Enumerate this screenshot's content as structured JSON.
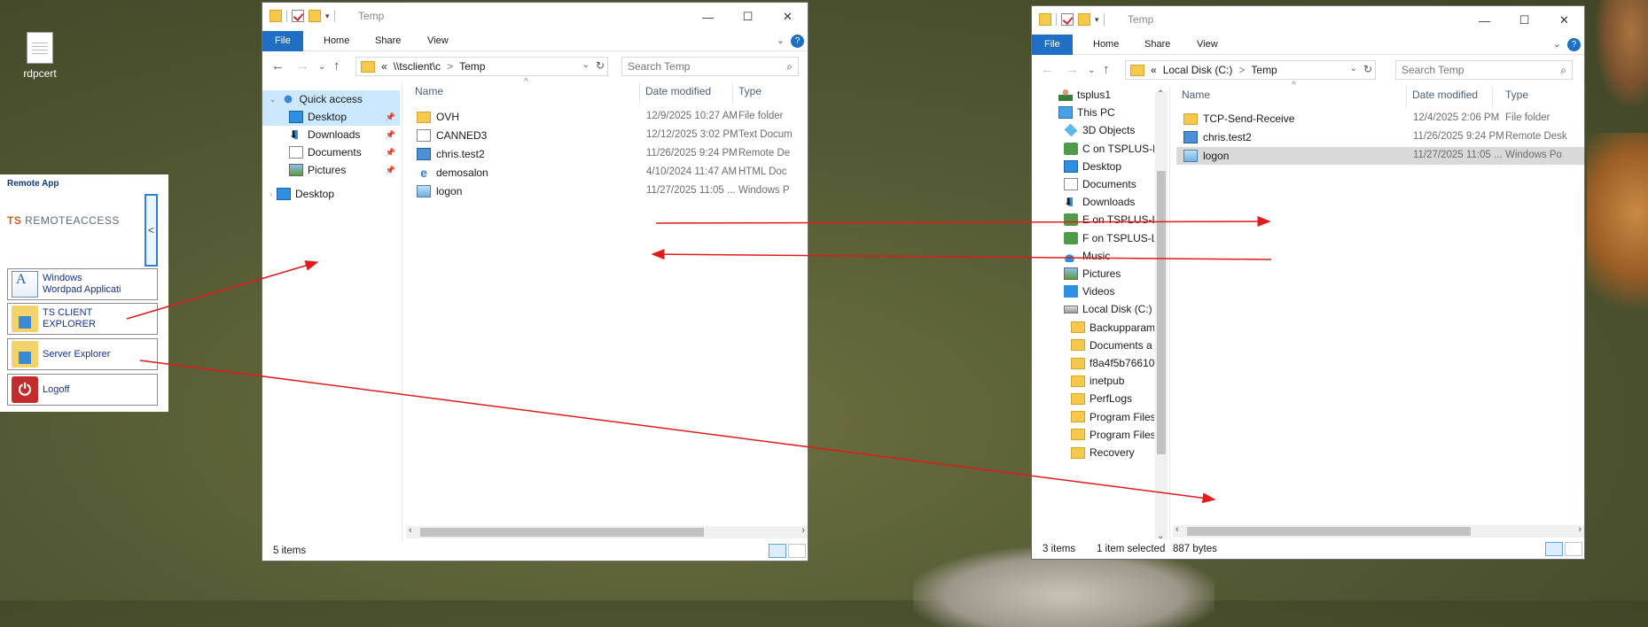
{
  "desktop": {
    "icon_label": "rdpcert",
    "icon": "document-icon"
  },
  "remote_app": {
    "title": "Remote App",
    "logo": "TS REMOTEACCESS",
    "collapse_glyph": "<",
    "buttons": [
      {
        "label_line1": "Windows",
        "label_line2": "Wordpad Applicati",
        "icon": "wordpad-icon"
      },
      {
        "label_line1": "TS CLIENT",
        "label_line2": "EXPLORER",
        "icon": "folder-icon"
      },
      {
        "label_line1": "Server Explorer",
        "label_line2": "",
        "icon": "folder-icon"
      },
      {
        "label_line1": "Logoff",
        "label_line2": "",
        "icon": "power-icon"
      }
    ]
  },
  "left_window": {
    "title": "Temp",
    "ribbon_tabs": [
      "File",
      "Home",
      "Share",
      "View"
    ],
    "address": {
      "prefix": "«",
      "segments": [
        "\\\\tsclient\\c",
        "Temp"
      ],
      "sep": ">"
    },
    "search_placeholder": "Search Temp",
    "nav": [
      {
        "label": "Quick access",
        "icon": "star-icon"
      },
      {
        "label": "Desktop",
        "icon": "desktop-icon"
      },
      {
        "label": "Downloads",
        "icon": "download-icon"
      },
      {
        "label": "Documents",
        "icon": "documents-icon"
      },
      {
        "label": "Pictures",
        "icon": "pictures-icon"
      },
      {
        "label": "Desktop",
        "icon": "desktop-icon"
      }
    ],
    "columns": [
      "Name",
      "Date modified",
      "Type"
    ],
    "files": [
      {
        "name": "OVH",
        "date": "12/9/2025 10:27 AM",
        "type": "File folder",
        "icon": "folder-icon"
      },
      {
        "name": "CANNED3",
        "date": "12/12/2025 3:02 PM",
        "type": "Text Docum",
        "icon": "text-file-icon"
      },
      {
        "name": "chris.test2",
        "date": "11/26/2025 9:24 PM",
        "type": "Remote De",
        "icon": "rdp-file-icon"
      },
      {
        "name": "demosalon",
        "date": "4/10/2024 11:47 AM",
        "type": "HTML Doc",
        "icon": "html-file-icon"
      },
      {
        "name": "logon",
        "date": "11/27/2025 11:05 ...",
        "type": "Windows P",
        "icon": "image-file-icon"
      }
    ],
    "status": {
      "items": "5 items"
    }
  },
  "right_window": {
    "title": "Temp",
    "ribbon_tabs": [
      "File",
      "Home",
      "Share",
      "View"
    ],
    "address": {
      "prefix": "«",
      "segments": [
        "Local Disk (C:)",
        "Temp"
      ],
      "sep": ">"
    },
    "search_placeholder": "Search Temp",
    "nav": [
      {
        "label": "tsplus1",
        "icon": "user-icon"
      },
      {
        "label": "This PC",
        "icon": "this-pc-icon"
      },
      {
        "label": "3D Objects",
        "icon": "3d-objects-icon"
      },
      {
        "label": "C on TSPLUS-L",
        "icon": "network-drive-icon"
      },
      {
        "label": "Desktop",
        "icon": "desktop-icon"
      },
      {
        "label": "Documents",
        "icon": "documents-icon"
      },
      {
        "label": "Downloads",
        "icon": "download-icon"
      },
      {
        "label": "E on TSPLUS-L",
        "icon": "network-drive-icon"
      },
      {
        "label": "F on TSPLUS-L",
        "icon": "network-drive-icon"
      },
      {
        "label": "Music",
        "icon": "music-icon"
      },
      {
        "label": "Pictures",
        "icon": "pictures-icon"
      },
      {
        "label": "Videos",
        "icon": "videos-icon"
      },
      {
        "label": "Local Disk (C:)",
        "icon": "disk-icon"
      },
      {
        "label": "Backupparam",
        "icon": "folder-icon"
      },
      {
        "label": "Documents a",
        "icon": "folder-icon"
      },
      {
        "label": "f8a4f5b76610",
        "icon": "folder-icon"
      },
      {
        "label": "inetpub",
        "icon": "folder-icon"
      },
      {
        "label": "PerfLogs",
        "icon": "folder-icon"
      },
      {
        "label": "Program Files",
        "icon": "folder-icon"
      },
      {
        "label": "Program Files",
        "icon": "folder-icon"
      },
      {
        "label": "Recovery",
        "icon": "folder-icon"
      }
    ],
    "columns": [
      "Name",
      "Date modified",
      "Type"
    ],
    "files": [
      {
        "name": "TCP-Send-Receive",
        "date": "12/4/2025 2:06 PM",
        "type": "File folder",
        "icon": "folder-icon"
      },
      {
        "name": "chris.test2",
        "date": "11/26/2025 9:24 PM",
        "type": "Remote Desk",
        "icon": "rdp-file-icon"
      },
      {
        "name": "logon",
        "date": "11/27/2025 11:05 ...",
        "type": "Windows Po",
        "icon": "image-file-icon"
      }
    ],
    "status": {
      "items": "3 items",
      "selected": "1 item selected",
      "size": "887 bytes"
    }
  },
  "colors": {
    "accent": "#1f6fc4",
    "selection": "#cce8ff",
    "arrow": "#e01b1b",
    "remote_app_text": "#12309a"
  }
}
